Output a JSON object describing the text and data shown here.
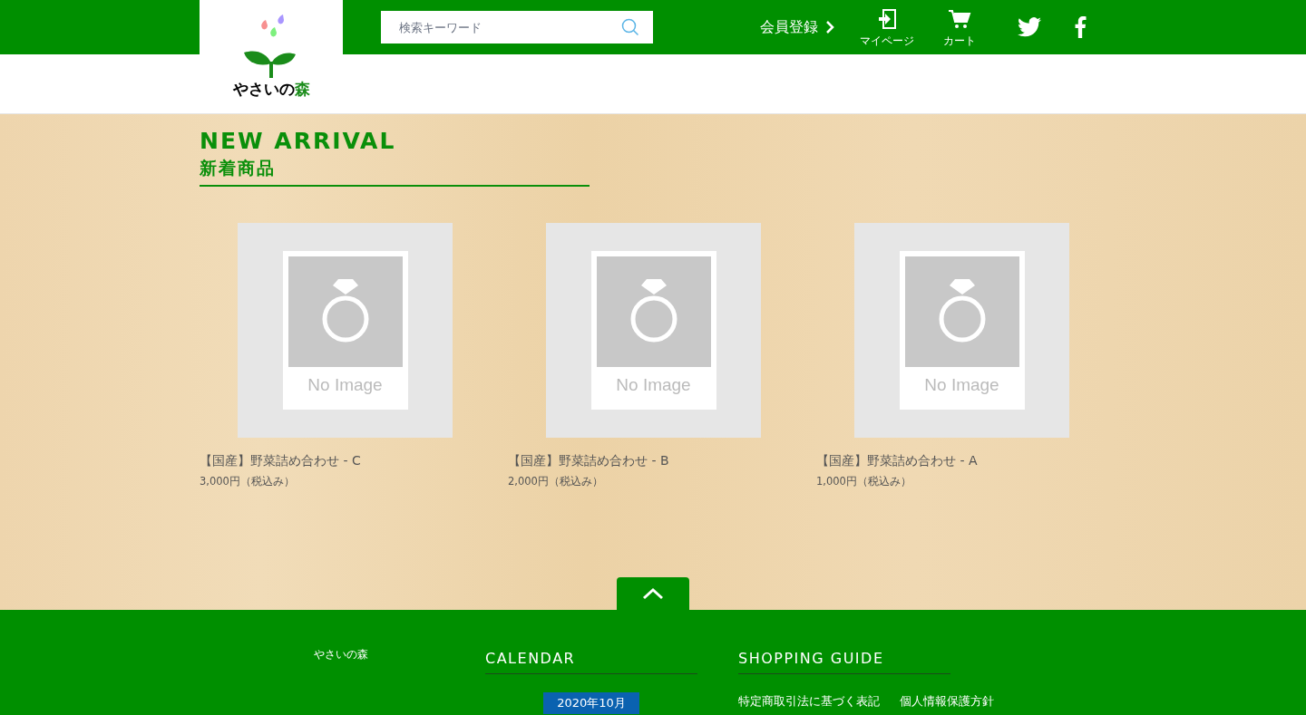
{
  "header": {
    "logo": {
      "text": "やさいの",
      "accent": "森"
    },
    "search": {
      "placeholder": "検索キーワード"
    },
    "register_link": "会員登録",
    "nav": [
      {
        "kind": "mypage",
        "label": "マイページ"
      },
      {
        "kind": "cart",
        "label": "カート"
      }
    ],
    "social": [
      {
        "kind": "twitter"
      },
      {
        "kind": "facebook"
      }
    ]
  },
  "section": {
    "title": "NEW ARRIVAL",
    "subtitle": "新着商品"
  },
  "products": [
    {
      "image_label": "No Image",
      "name": "【国産】野菜詰め合わせ - C",
      "price": "3,000円（税込み）"
    },
    {
      "image_label": "No Image",
      "name": "【国産】野菜詰め合わせ - B",
      "price": "2,000円（税込み）"
    },
    {
      "image_label": "No Image",
      "name": "【国産】野菜詰め合わせ - A",
      "price": "1,000円（税込み）"
    }
  ],
  "footer": {
    "shop_name": "やさいの森",
    "calendar": {
      "heading": "CALENDAR",
      "month": "2020年10月"
    },
    "guide": {
      "heading": "SHOPPING GUIDE",
      "links": [
        "特定商取引法に基づく表記",
        "個人情報保護方針"
      ]
    }
  }
}
